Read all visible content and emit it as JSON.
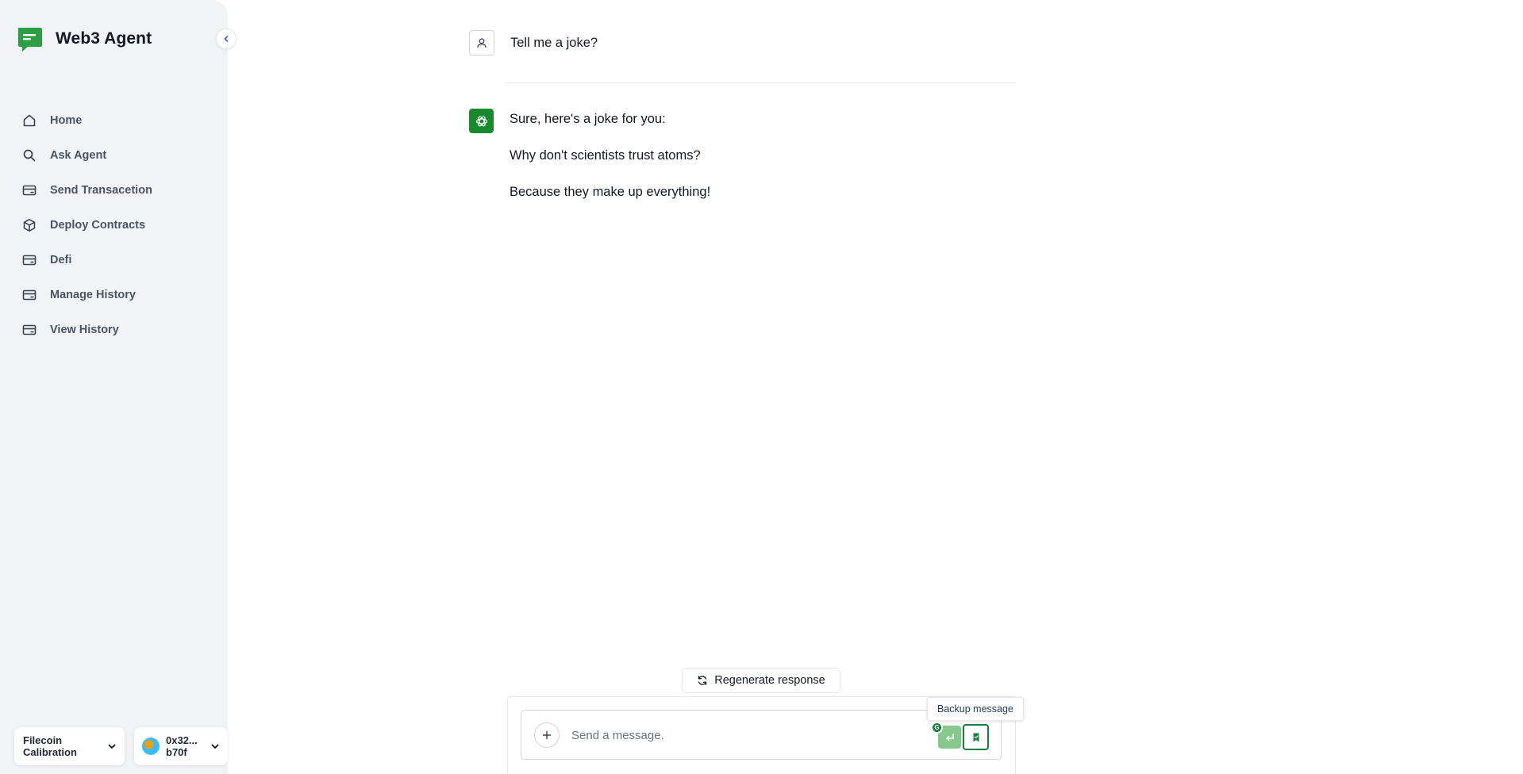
{
  "app": {
    "title": "Web3 Agent"
  },
  "colors": {
    "accent": "#188a2e",
    "sidebar_bg": "#f1f3f7",
    "send_disabled": "#86c98f"
  },
  "sidebar": {
    "collapse_icon": "chevron-left-icon",
    "items": [
      {
        "label": "Home",
        "icon": "home-icon"
      },
      {
        "label": "Ask Agent",
        "icon": "search-icon"
      },
      {
        "label": "Send Transacetion",
        "icon": "card-icon"
      },
      {
        "label": "Deploy Contracts",
        "icon": "cube-icon"
      },
      {
        "label": "Defi",
        "icon": "card-icon"
      },
      {
        "label": "Manage History",
        "icon": "card-icon"
      },
      {
        "label": "View History",
        "icon": "card-icon"
      }
    ],
    "network": {
      "label_line1": "Filecoin",
      "label_line2": "Calibration"
    },
    "account": {
      "label_line1": "0x32...",
      "label_line2": "b70f"
    }
  },
  "chat": {
    "messages": [
      {
        "role": "user",
        "lines": [
          "Tell me a joke?"
        ]
      },
      {
        "role": "assistant",
        "lines": [
          "Sure, here's a joke for you:",
          "Why don't scientists trust atoms?",
          "Because they make up everything!"
        ]
      }
    ],
    "regenerate_label": "Regenerate response",
    "input_placeholder": "Send a message.",
    "backup_tooltip": "Backup message"
  }
}
